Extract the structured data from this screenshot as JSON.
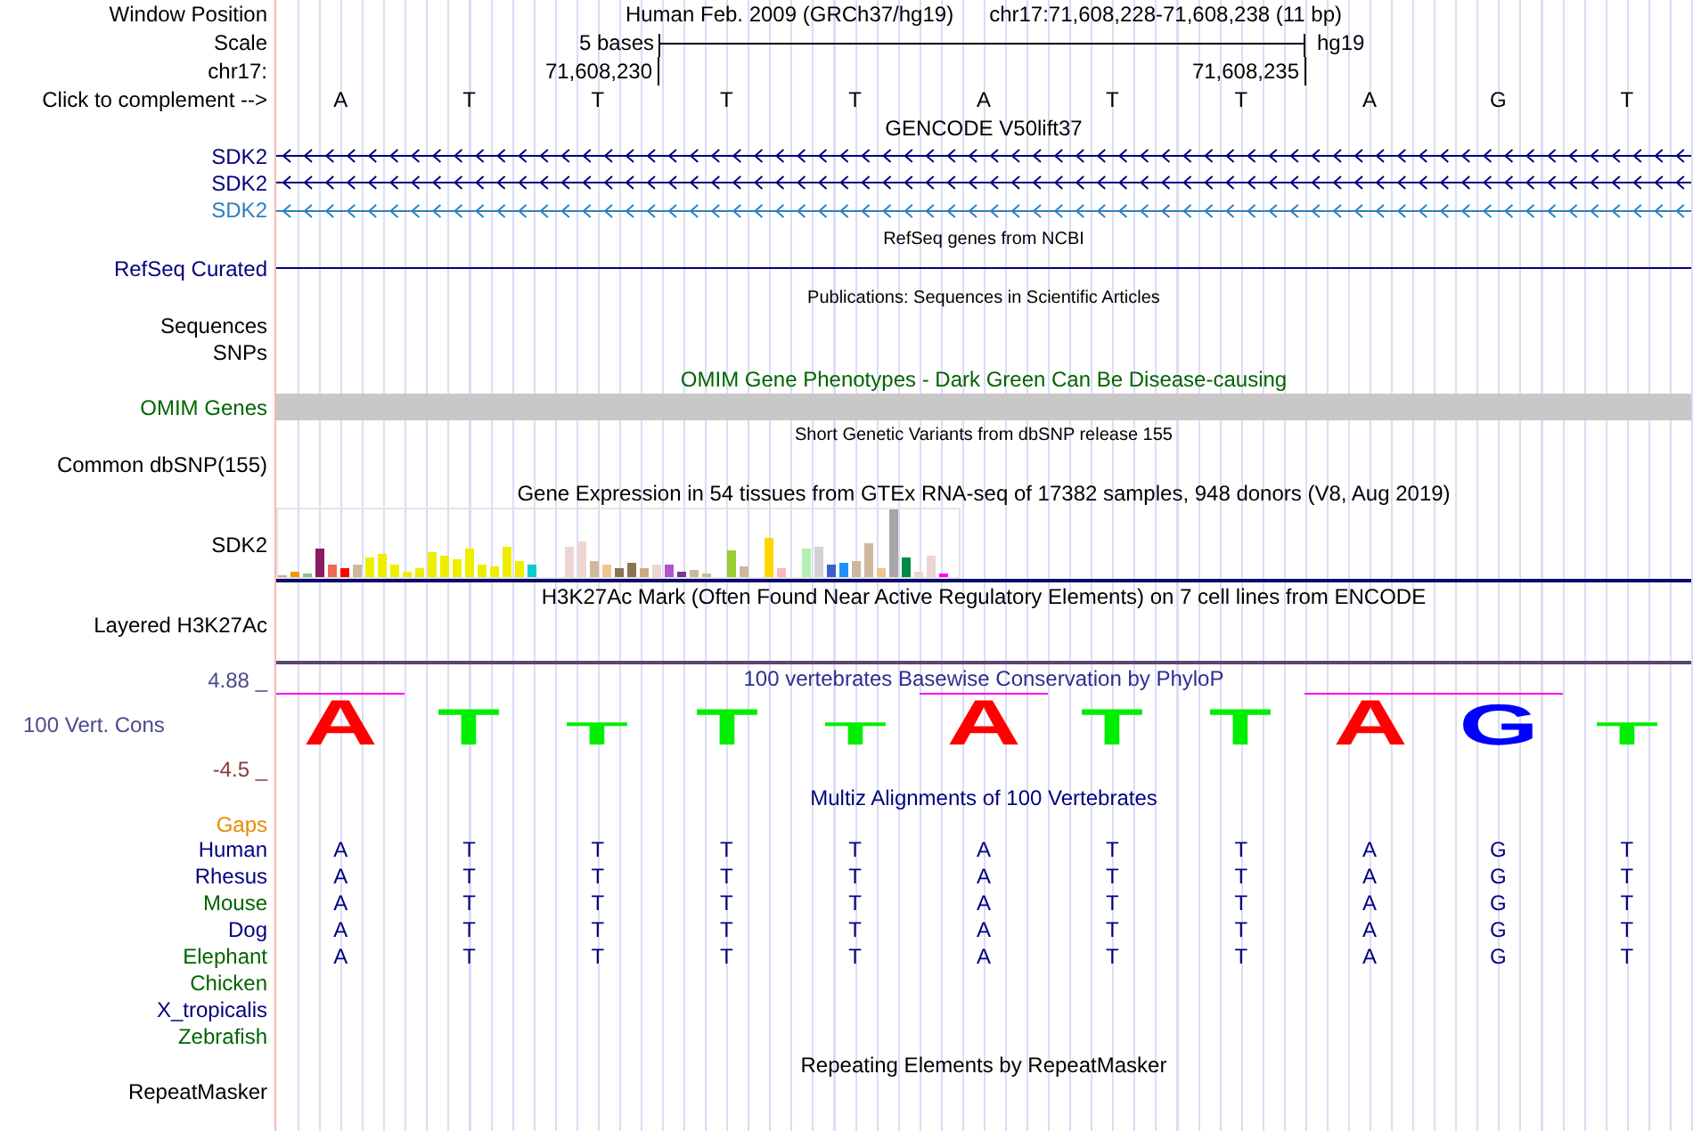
{
  "header": {
    "window_position_label": "Window Position",
    "assembly": "Human Feb. 2009 (GRCh37/hg19)",
    "position": "chr17:71,608,228-71,608,238 (11 bp)",
    "scale_label": "Scale",
    "scale_text": "5 bases",
    "scale_db": "hg19",
    "chrom_label": "chr17:",
    "coord_start": "71,608,230",
    "coord_end": "71,608,235",
    "complement_label": "Click to complement -->"
  },
  "bases": [
    "A",
    "T",
    "T",
    "T",
    "T",
    "A",
    "T",
    "T",
    "A",
    "G",
    "T"
  ],
  "gencode": {
    "title": "GENCODE V50lift37",
    "genes": [
      {
        "name": "SDK2",
        "color": "#000080"
      },
      {
        "name": "SDK2",
        "color": "#000080"
      },
      {
        "name": "SDK2",
        "color": "#2f7fbf"
      }
    ]
  },
  "refseq": {
    "title": "RefSeq genes from NCBI",
    "label": "RefSeq Curated"
  },
  "publications": {
    "title": "Publications: Sequences in Scientific Articles",
    "labels": [
      "Sequences",
      "SNPs"
    ]
  },
  "omim": {
    "title": "OMIM Gene Phenotypes - Dark Green Can Be Disease-causing",
    "label": "OMIM Genes"
  },
  "dbsnp": {
    "title": "Short Genetic Variants from dbSNP release 155",
    "label": "Common dbSNP(155)"
  },
  "gtex": {
    "title": "Gene Expression in 54 tissues from GTEx RNA-seq of 17382 samples, 948 donors (V8, Aug 2019)",
    "label": "SDK2"
  },
  "h3k27ac": {
    "title": "H3K27Ac Mark (Often Found Near Active Regulatory Elements) on 7 cell lines from ENCODE",
    "label": "Layered H3K27Ac"
  },
  "conservation": {
    "title": "100 vertebrates Basewise Conservation by PhyloP",
    "label": "100 Vert. Cons",
    "y_max": "4.88 _",
    "y_min": "-4.5 _",
    "logo": [
      {
        "base": "A",
        "color": "#ff0000",
        "highlighted": true
      },
      {
        "base": "T",
        "color": "#00ee00",
        "highlighted": false
      },
      {
        "base": "T",
        "color": "#00ee00",
        "highlighted": false
      },
      {
        "base": "T",
        "color": "#00ee00",
        "highlighted": false
      },
      {
        "base": "T",
        "color": "#00ee00",
        "highlighted": false
      },
      {
        "base": "A",
        "color": "#ff0000",
        "highlighted": true
      },
      {
        "base": "T",
        "color": "#00ee00",
        "highlighted": false
      },
      {
        "base": "T",
        "color": "#00ee00",
        "highlighted": false
      },
      {
        "base": "A",
        "color": "#ff0000",
        "highlighted": true
      },
      {
        "base": "G",
        "color": "#0000ff",
        "highlighted": true
      },
      {
        "base": "T",
        "color": "#00ee00",
        "highlighted": false
      }
    ]
  },
  "multiz": {
    "title": "Multiz Alignments of 100 Vertebrates",
    "gaps_label": "Gaps",
    "species": [
      {
        "name": "Human",
        "color": "#000080",
        "bases": [
          "A",
          "T",
          "T",
          "T",
          "T",
          "A",
          "T",
          "T",
          "A",
          "G",
          "T"
        ]
      },
      {
        "name": "Rhesus",
        "color": "#000080",
        "bases": [
          "A",
          "T",
          "T",
          "T",
          "T",
          "A",
          "T",
          "T",
          "A",
          "G",
          "T"
        ]
      },
      {
        "name": "Mouse",
        "color": "#006400",
        "bases": [
          "A",
          "T",
          "T",
          "T",
          "T",
          "A",
          "T",
          "T",
          "A",
          "G",
          "T"
        ]
      },
      {
        "name": "Dog",
        "color": "#000080",
        "bases": [
          "A",
          "T",
          "T",
          "T",
          "T",
          "A",
          "T",
          "T",
          "A",
          "G",
          "T"
        ]
      },
      {
        "name": "Elephant",
        "color": "#006400",
        "bases": [
          "A",
          "T",
          "T",
          "T",
          "T",
          "A",
          "T",
          "T",
          "A",
          "G",
          "T"
        ]
      },
      {
        "name": "Chicken",
        "color": "#006400"
      },
      {
        "name": "X_tropicalis",
        "color": "#000080"
      },
      {
        "name": "Zebrafish",
        "color": "#006400"
      }
    ]
  },
  "repeatmasker": {
    "title": "Repeating Elements by RepeatMasker",
    "label": "RepeatMasker"
  }
}
